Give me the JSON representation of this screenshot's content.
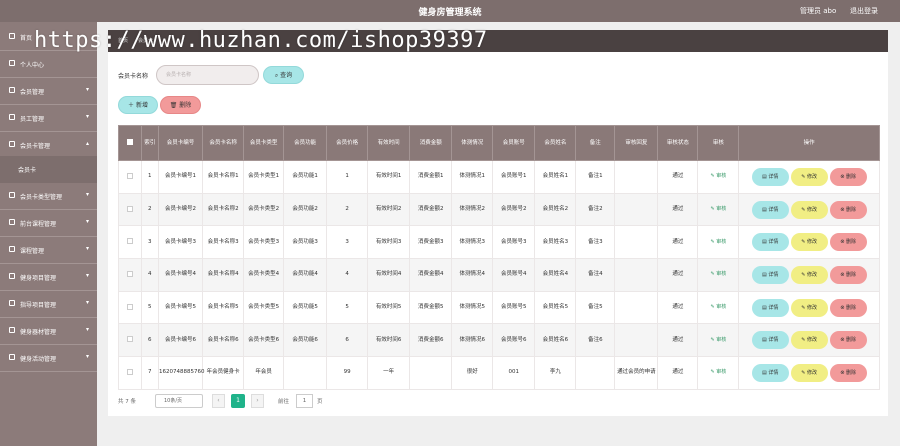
{
  "header": {
    "title": "健身房管理系统",
    "user": "管理员 abo",
    "logout": "退出登录"
  },
  "watermark": "https://www.huzhan.com/ishop39397",
  "breadcrumb": {
    "home": "首页",
    "current": "会员卡"
  },
  "sidebar": {
    "items": [
      {
        "label": "首页"
      },
      {
        "label": "个人中心"
      },
      {
        "label": "会员管理"
      },
      {
        "label": "员工管理"
      },
      {
        "label": "会员卡管理"
      },
      {
        "label": "会员卡"
      },
      {
        "label": "会员卡类型管理"
      },
      {
        "label": "前台课程管理"
      },
      {
        "label": "课程管理"
      },
      {
        "label": "健身项目管理"
      },
      {
        "label": "指导项目管理"
      },
      {
        "label": "健身器材管理"
      },
      {
        "label": "健身活动管理"
      }
    ]
  },
  "search": {
    "label": "会员卡名称",
    "placeholder": "会员卡名称",
    "button": "查询"
  },
  "actions": {
    "add": "新增",
    "delete": "删除"
  },
  "table": {
    "headers": [
      "索引",
      "会员卡编号",
      "会员卡名称",
      "会员卡类型",
      "会员功能",
      "会员价格",
      "有效时间",
      "消费金额",
      "体测情况",
      "会员账号",
      "会员姓名",
      "备注",
      "审核回复",
      "审核状态",
      "审核",
      "操作"
    ],
    "audit_label": "审核",
    "ops": {
      "detail": "详情",
      "edit": "修改",
      "delete": "删除"
    },
    "rows": [
      {
        "index": "1",
        "no": "会员卡编号1",
        "name": "会员卡名称1",
        "type": "会员卡类型1",
        "func": "会员功能1",
        "price": "1",
        "valid": "有效时间1",
        "spend": "消费金额1",
        "body": "体测情况1",
        "account": "会员账号1",
        "member": "会员姓名1",
        "remark": "备注1",
        "reply": "",
        "status": "通过"
      },
      {
        "index": "2",
        "no": "会员卡编号2",
        "name": "会员卡名称2",
        "type": "会员卡类型2",
        "func": "会员功能2",
        "price": "2",
        "valid": "有效时间2",
        "spend": "消费金额2",
        "body": "体测情况2",
        "account": "会员账号2",
        "member": "会员姓名2",
        "remark": "备注2",
        "reply": "",
        "status": "通过"
      },
      {
        "index": "3",
        "no": "会员卡编号3",
        "name": "会员卡名称3",
        "type": "会员卡类型3",
        "func": "会员功能3",
        "price": "3",
        "valid": "有效时间3",
        "spend": "消费金额3",
        "body": "体测情况3",
        "account": "会员账号3",
        "member": "会员姓名3",
        "remark": "备注3",
        "reply": "",
        "status": "通过"
      },
      {
        "index": "4",
        "no": "会员卡编号4",
        "name": "会员卡名称4",
        "type": "会员卡类型4",
        "func": "会员功能4",
        "price": "4",
        "valid": "有效时间4",
        "spend": "消费金额4",
        "body": "体测情况4",
        "account": "会员账号4",
        "member": "会员姓名4",
        "remark": "备注4",
        "reply": "",
        "status": "通过"
      },
      {
        "index": "5",
        "no": "会员卡编号5",
        "name": "会员卡名称5",
        "type": "会员卡类型5",
        "func": "会员功能5",
        "price": "5",
        "valid": "有效时间5",
        "spend": "消费金额5",
        "body": "体测情况5",
        "account": "会员账号5",
        "member": "会员姓名5",
        "remark": "备注5",
        "reply": "",
        "status": "通过"
      },
      {
        "index": "6",
        "no": "会员卡编号6",
        "name": "会员卡名称6",
        "type": "会员卡类型6",
        "func": "会员功能6",
        "price": "6",
        "valid": "有效时间6",
        "spend": "消费金额6",
        "body": "体测情况6",
        "account": "会员账号6",
        "member": "会员姓名6",
        "remark": "备注6",
        "reply": "",
        "status": "通过"
      },
      {
        "index": "7",
        "no": "1620748885760",
        "name": "年会员健身卡",
        "type": "年会员",
        "func": "",
        "price": "99",
        "valid": "一年",
        "spend": "",
        "body": "很好",
        "account": "001",
        "member": "李九",
        "remark": "",
        "reply": "通过会员的申请",
        "status": "通过"
      }
    ]
  },
  "pager": {
    "total": "共 7 条",
    "size": "10条/页",
    "prev": "‹",
    "current": "1",
    "next": "›",
    "goto_label": "前往",
    "goto_value": "1",
    "page_unit": "页"
  },
  "colors": {
    "topbar": "#7d6e6d",
    "sidebar": "#8c7b7a",
    "accent": "#a7e6e7",
    "danger": "#f29a9a",
    "edit": "#f1ee84",
    "pager_active": "#1fb38a"
  }
}
